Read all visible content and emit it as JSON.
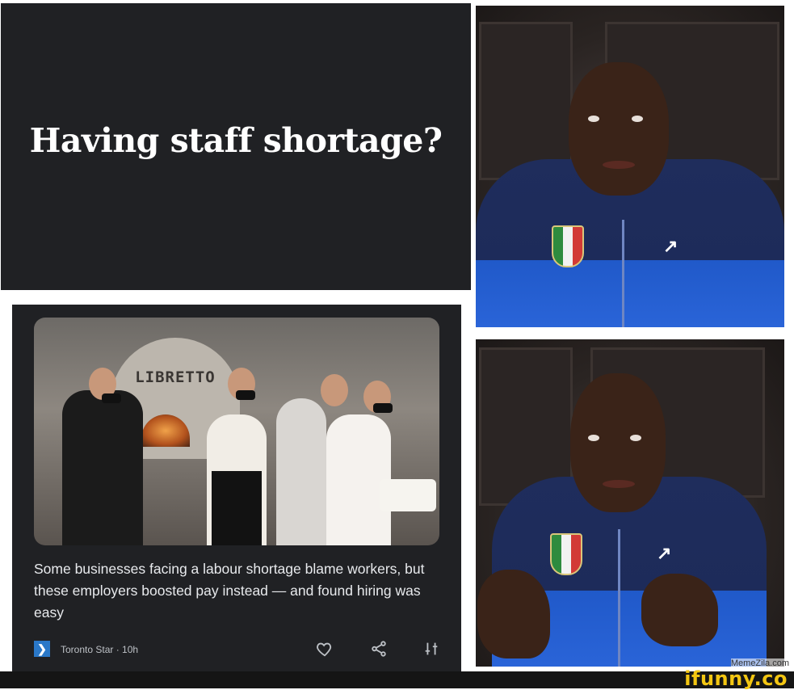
{
  "caption": {
    "text": "Having staff shortage?"
  },
  "news_card": {
    "image_sign": "LIBRETTO",
    "headline": "Some businesses facing a labour shortage blame workers, but these employers boosted pay instead — and found hiring was easy",
    "source": "Toronto Star · 10h",
    "icons": [
      "heart-icon",
      "share-icon",
      "more-icon"
    ]
  },
  "watermarks": {
    "memezila": "MemeZila.com",
    "ifunny": "ifunny.co"
  },
  "colors": {
    "card_background": "#202124",
    "caption_text": "#ffffff",
    "ifunny_yellow": "#f3c612"
  }
}
